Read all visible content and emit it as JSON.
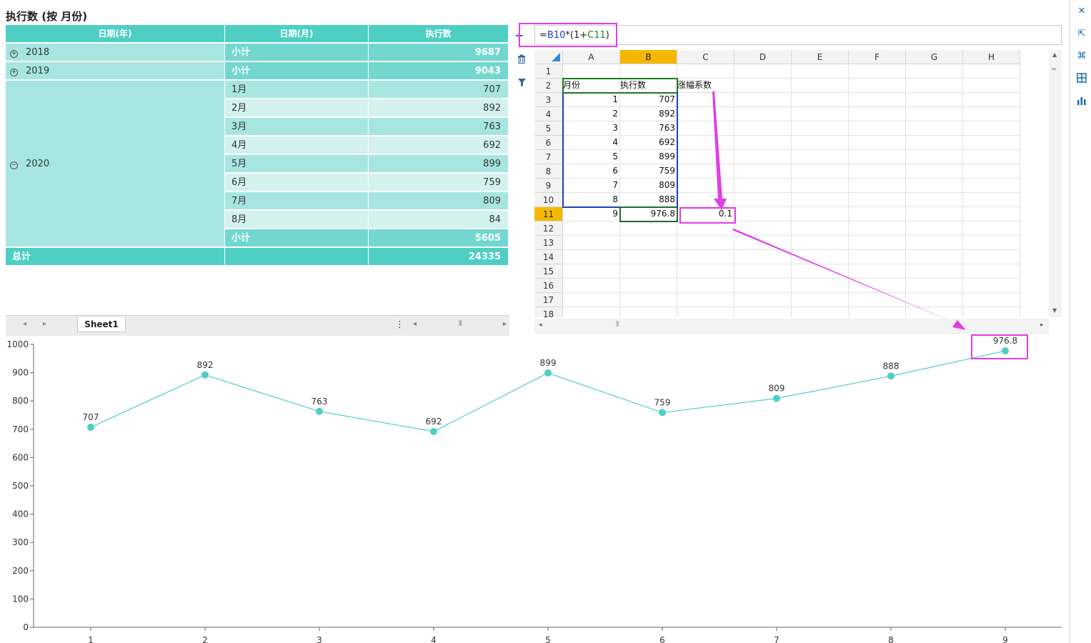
{
  "page": {
    "title": "执行数 (按 月份)"
  },
  "pivot": {
    "headers": [
      "日期(年)",
      "日期(月)",
      "执行数"
    ],
    "rows": [
      {
        "year": "2018",
        "expander": "⊕",
        "month": "小计",
        "value": "9687"
      },
      {
        "year": "2019",
        "expander": "⊕",
        "month": "小计",
        "value": "9043"
      },
      {
        "year": "2020",
        "expander": "⊖",
        "month": "1月",
        "value": "707"
      },
      {
        "year": "",
        "expander": "",
        "month": "2月",
        "value": "892"
      },
      {
        "year": "",
        "expander": "",
        "month": "3月",
        "value": "763"
      },
      {
        "year": "",
        "expander": "",
        "month": "4月",
        "value": "692"
      },
      {
        "year": "",
        "expander": "",
        "month": "5月",
        "value": "899"
      },
      {
        "year": "",
        "expander": "",
        "month": "6月",
        "value": "759"
      },
      {
        "year": "",
        "expander": "",
        "month": "7月",
        "value": "809"
      },
      {
        "year": "",
        "expander": "",
        "month": "8月",
        "value": "84"
      },
      {
        "year": "",
        "expander": "",
        "month": "小计",
        "value": "5605"
      }
    ],
    "total": {
      "label": "总计",
      "value": "24335"
    },
    "sheet_tab": "Sheet1",
    "nav_prev": "◂",
    "nav_next": "▸",
    "more": "⋮"
  },
  "spreadsheet": {
    "formula": {
      "eq": "=",
      "ref1": "B10",
      "mid": "*(1+",
      "ref2": "C11",
      "end": ")"
    },
    "columns": [
      "A",
      "B",
      "C",
      "D",
      "E",
      "F",
      "G",
      "H"
    ],
    "selected_column": "B",
    "rows": [
      "1",
      "2",
      "3",
      "4",
      "5",
      "6",
      "7",
      "8",
      "9",
      "10",
      "11",
      "12",
      "13",
      "14",
      "15",
      "16",
      "17",
      "18"
    ],
    "selected_row": "11",
    "header_row": {
      "A": "月份",
      "B": "执行数",
      "C": "涨幅系数"
    },
    "data": [
      {
        "A": "1",
        "B": "707"
      },
      {
        "A": "2",
        "B": "892"
      },
      {
        "A": "3",
        "B": "763"
      },
      {
        "A": "4",
        "B": "692"
      },
      {
        "A": "5",
        "B": "899"
      },
      {
        "A": "6",
        "B": "759"
      },
      {
        "A": "7",
        "B": "809"
      },
      {
        "A": "8",
        "B": "888"
      },
      {
        "A": "9",
        "B": "976.8",
        "C": "0.1"
      }
    ],
    "icons": [
      "plus-icon",
      "trash-icon",
      "filter-icon"
    ]
  },
  "right_toolbar": {
    "icons": [
      "close-icon",
      "export-icon",
      "layout-icon",
      "grid-icon",
      "chart-icon"
    ]
  },
  "chart_data": {
    "type": "line",
    "categories": [
      "1",
      "2",
      "3",
      "4",
      "5",
      "6",
      "7",
      "8",
      "9"
    ],
    "series": [
      {
        "values": [
          707,
          892,
          763,
          692,
          899,
          759,
          809,
          888,
          976.8
        ],
        "color": "#4fcfc4"
      }
    ],
    "data_labels": [
      "707",
      "892",
      "763",
      "692",
      "899",
      "759",
      "809",
      "888",
      "976.8"
    ],
    "ylim": [
      0,
      1000
    ],
    "yticks": [
      0,
      100,
      200,
      300,
      400,
      500,
      600,
      700,
      800,
      900,
      1000
    ],
    "grid": false,
    "legend": "none",
    "title": "",
    "xlabel": "",
    "ylabel": ""
  },
  "colors": {
    "accent": "#4fcfc4",
    "highlight": "#e23ee6",
    "selected_header": "#f5b800"
  }
}
